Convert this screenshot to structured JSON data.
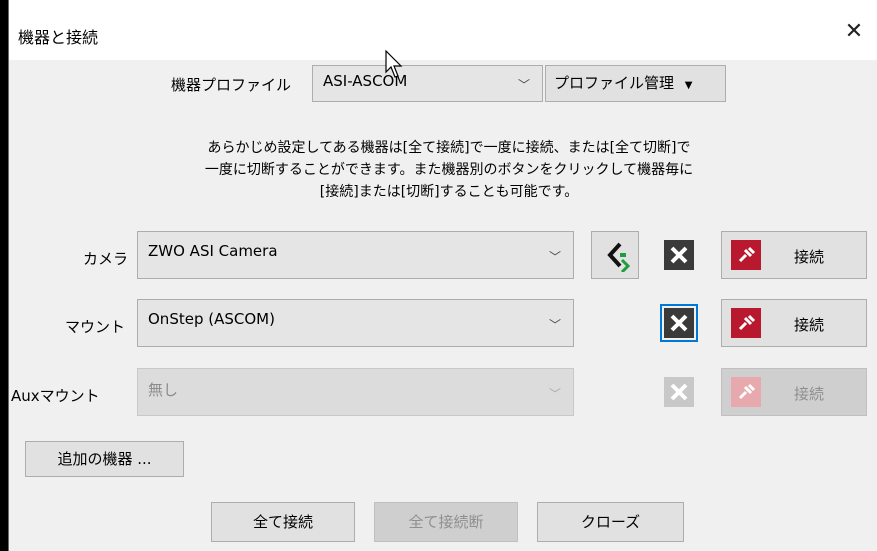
{
  "window": {
    "title": "機器と接続",
    "close_glyph": "✕"
  },
  "profile": {
    "label": "機器プロファイル",
    "value": "ASI-ASCOM",
    "manage_label": "プロファイル管理"
  },
  "description": {
    "line1": "あらかじめ設定してある機器は[全て接続]で一度に接続、または[全て切断]で",
    "line2": "一度に切断することができます。また機器別のボタンをクリックして機器毎に",
    "line3": "[接続]または[切断]することも可能です。"
  },
  "devices": [
    {
      "label": "カメラ",
      "value": "ZWO ASI Camera",
      "connect_label": "接続",
      "enabled": true
    },
    {
      "label": "マウント",
      "value": "OnStep (ASCOM)",
      "connect_label": "接続",
      "enabled": true
    },
    {
      "label": "Auxマウント",
      "value": "無し",
      "connect_label": "接続",
      "enabled": false
    }
  ],
  "more_devices_label": "追加の機器 ...",
  "footer": {
    "connect_all": "全て接続",
    "disconnect_all": "全て接続断",
    "close": "クローズ"
  },
  "colors": {
    "accent": "#0078d7",
    "plug_red": "#b8192e",
    "swap_green": "#1f9d3a"
  },
  "icons": [
    "close-icon",
    "chevron-down-icon",
    "swap-icon",
    "tools-icon",
    "plug-icon",
    "cursor-icon"
  ]
}
